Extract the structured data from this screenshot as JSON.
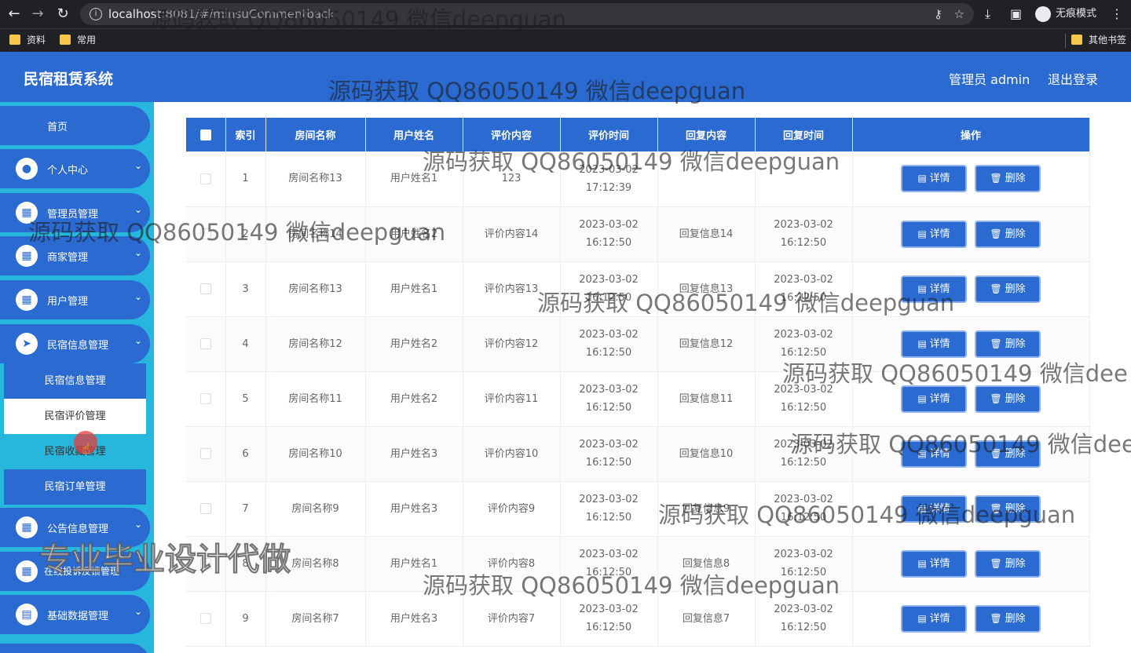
{
  "browser": {
    "url_host": "localhost",
    "url_rest": ":8081/#/minsuCommentback",
    "incognito_label": "无痕模式",
    "bookmarks": [
      "资料",
      "常用"
    ],
    "other_bookmarks": "其他书签"
  },
  "header": {
    "title": "民宿租赁系统",
    "user": "管理员 admin",
    "logout": "退出登录"
  },
  "sidebar": {
    "home": "首页",
    "menus": [
      {
        "label": "个人中心",
        "icon": "user-icon"
      },
      {
        "label": "管理员管理",
        "icon": "grid-icon"
      },
      {
        "label": "商家管理",
        "icon": "grid-icon"
      },
      {
        "label": "用户管理",
        "icon": "grid-icon"
      },
      {
        "label": "民宿信息管理",
        "icon": "send-icon"
      },
      {
        "label": "公告信息管理",
        "icon": "grid-icon"
      },
      {
        "label": "在线投诉反馈管理",
        "icon": "grid-icon"
      },
      {
        "label": "基础数据管理",
        "icon": "clipboard-icon"
      }
    ],
    "submenu": [
      "民宿信息管理",
      "民宿评价管理",
      "民宿收藏管理",
      "民宿订单管理"
    ]
  },
  "table": {
    "headers": [
      "索引",
      "房间名称",
      "用户姓名",
      "评价内容",
      "评价时间",
      "回复内容",
      "回复时间",
      "操作"
    ],
    "rows": [
      {
        "idx": "1",
        "room": "房间名称13",
        "user": "用户姓名1",
        "comment": "123",
        "ctime": "2023-03-02 17:12:39",
        "reply": "",
        "rtime": ""
      },
      {
        "idx": "2",
        "room": "房间名称14",
        "user": "用户姓名2",
        "comment": "评价内容14",
        "ctime": "2023-03-02 16:12:50",
        "reply": "回复信息14",
        "rtime": "2023-03-02 16:12:50"
      },
      {
        "idx": "3",
        "room": "房间名称13",
        "user": "用户姓名1",
        "comment": "评价内容13",
        "ctime": "2023-03-02 16:12:50",
        "reply": "回复信息13",
        "rtime": "2023-03-02 16:12:50"
      },
      {
        "idx": "4",
        "room": "房间名称12",
        "user": "用户姓名2",
        "comment": "评价内容12",
        "ctime": "2023-03-02 16:12:50",
        "reply": "回复信息12",
        "rtime": "2023-03-02 16:12:50"
      },
      {
        "idx": "5",
        "room": "房间名称11",
        "user": "用户姓名2",
        "comment": "评价内容11",
        "ctime": "2023-03-02 16:12:50",
        "reply": "回复信息11",
        "rtime": "2023-03-02 16:12:50"
      },
      {
        "idx": "6",
        "room": "房间名称10",
        "user": "用户姓名3",
        "comment": "评价内容10",
        "ctime": "2023-03-02 16:12:50",
        "reply": "回复信息10",
        "rtime": "2023-03-02 16:12:50"
      },
      {
        "idx": "7",
        "room": "房间名称9",
        "user": "用户姓名3",
        "comment": "评价内容9",
        "ctime": "2023-03-02 16:12:50",
        "reply": "回复信息9",
        "rtime": "2023-03-02 16:12:50"
      },
      {
        "idx": "8",
        "room": "房间名称8",
        "user": "用户姓名1",
        "comment": "评价内容8",
        "ctime": "2023-03-02 16:12:50",
        "reply": "回复信息8",
        "rtime": "2023-03-02 16:12:50"
      },
      {
        "idx": "9",
        "room": "房间名称7",
        "user": "用户姓名3",
        "comment": "评价内容7",
        "ctime": "2023-03-02 16:12:50",
        "reply": "回复信息7",
        "rtime": "2023-03-02 16:12:50"
      }
    ],
    "detail_label": "详情",
    "delete_label": "删除"
  },
  "watermarks": {
    "text": "源码获取 QQ86050149 微信deepguan",
    "cut1": "源码获取 QQ86050149 微信dee",
    "banner": "专业毕业设计代做"
  },
  "colors": {
    "primary": "#2a6ad1",
    "sidebar_bg": "#27b6dc"
  }
}
